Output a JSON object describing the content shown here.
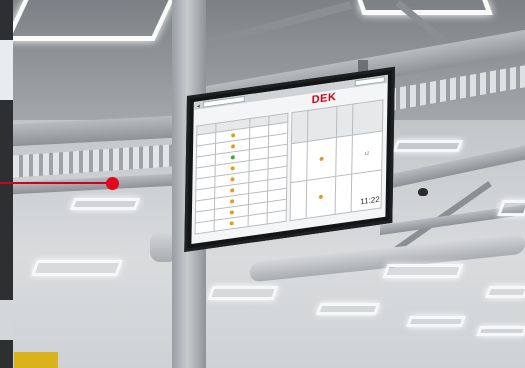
{
  "scene": {
    "description_label": "",
    "colors": {
      "brand_red": "#d0021b",
      "ceiling": "#9ea2a6",
      "monitor_bezel": "#141516",
      "screen_bg": "#f4f5f6"
    }
  },
  "monitor": {
    "screen_title": "",
    "logo": "DEK",
    "logo_sub": "",
    "clock": "11:22",
    "date": "",
    "table_left": {
      "headers": [
        "",
        "",
        "",
        ""
      ],
      "rows": [
        {
          "col1": "",
          "status": "#e69a1c",
          "col3": "",
          "col4": ""
        },
        {
          "col1": "",
          "status": "#e69a1c",
          "col3": "",
          "col4": ""
        },
        {
          "col1": "",
          "status": "#3aaa35",
          "col3": "",
          "col4": ""
        },
        {
          "col1": "",
          "status": "#e69a1c",
          "col3": "",
          "col4": ""
        },
        {
          "col1": "",
          "status": "#e69a1c",
          "col3": "",
          "col4": ""
        },
        {
          "col1": "",
          "status": "#e69a1c",
          "col3": "",
          "col4": ""
        },
        {
          "col1": "",
          "status": "#e69a1c",
          "col3": "",
          "col4": ""
        },
        {
          "col1": "",
          "status": "#e69a1c",
          "col3": "",
          "col4": ""
        },
        {
          "col1": "",
          "status": "#e69a1c",
          "col3": "",
          "col4": ""
        }
      ]
    },
    "table_right": {
      "headers": [
        "",
        "",
        "",
        ""
      ],
      "rows": [
        {
          "col1": "",
          "status": "#e69a1c",
          "col3": "",
          "col4": "12"
        },
        {
          "col1": "",
          "status": "#e69a1c",
          "col3": "",
          "col4": ""
        }
      ]
    },
    "footer": ""
  }
}
